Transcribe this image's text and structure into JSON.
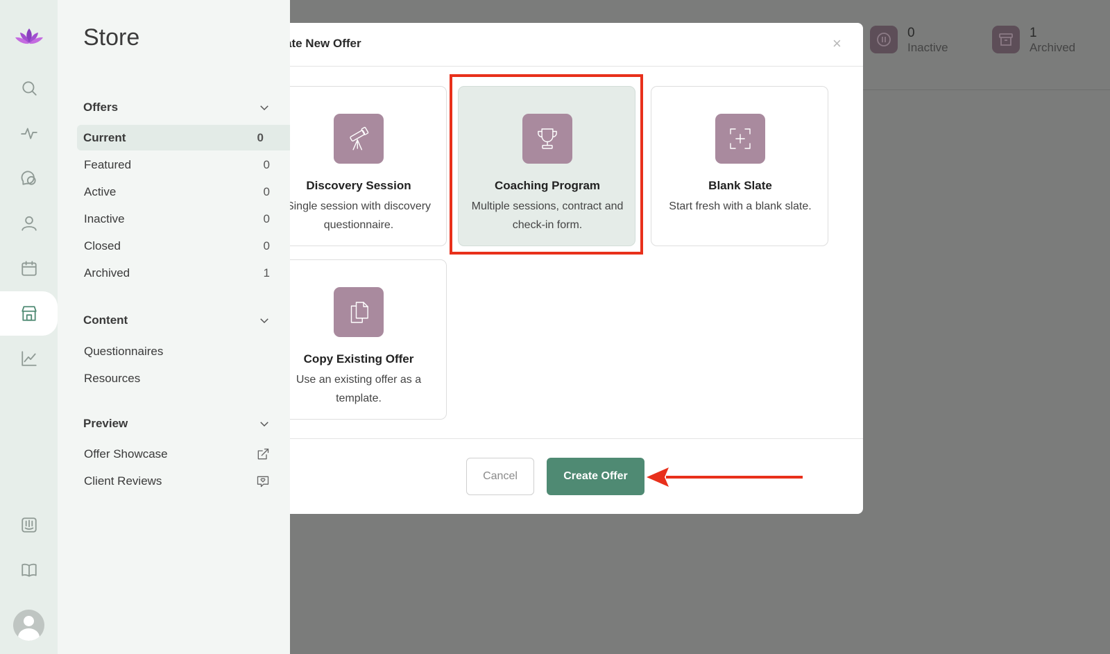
{
  "rail": {
    "icons": [
      "lotus-logo-icon",
      "search-icon",
      "activity-icon",
      "chat-icon",
      "user-icon",
      "calendar-icon",
      "store-icon",
      "chart-icon",
      "intercom-icon",
      "book-icon",
      "avatar"
    ]
  },
  "sidebar": {
    "title": "Store",
    "offers": {
      "heading": "Offers",
      "items": [
        {
          "label": "Current",
          "count": "0"
        },
        {
          "label": "Featured",
          "count": "0"
        },
        {
          "label": "Active",
          "count": "0"
        },
        {
          "label": "Inactive",
          "count": "0"
        },
        {
          "label": "Closed",
          "count": "0"
        },
        {
          "label": "Archived",
          "count": "1"
        }
      ]
    },
    "content": {
      "heading": "Content",
      "items": [
        {
          "label": "Questionnaires"
        },
        {
          "label": "Resources"
        }
      ]
    },
    "preview": {
      "heading": "Preview",
      "items": [
        {
          "label": "Offer Showcase"
        },
        {
          "label": "Client Reviews"
        }
      ]
    }
  },
  "header_stats": [
    {
      "value": "0",
      "label": "Inactive"
    },
    {
      "value": "1",
      "label": "Archived"
    }
  ],
  "modal": {
    "title": "ate New Offer",
    "close": "×",
    "cards": [
      {
        "title": "Discovery Session",
        "desc": "Single session with discovery questionnaire.",
        "icon": "telescope-icon"
      },
      {
        "title": "Coaching Program",
        "desc": "Multiple sessions, contract and check-in form.",
        "icon": "trophy-icon"
      },
      {
        "title": "Blank Slate",
        "desc": "Start fresh with a blank slate.",
        "icon": "blank-slate-icon"
      },
      {
        "title": "Copy Existing Offer",
        "desc": "Use an existing offer as a template.",
        "icon": "copy-icon"
      }
    ],
    "cancel_label": "Cancel",
    "create_label": "Create Offer"
  },
  "colors": {
    "accent": "#4f8a73",
    "card_icon": "#a98a9e",
    "annotation": "#e8301b",
    "overlay": "#7b7c7b"
  }
}
